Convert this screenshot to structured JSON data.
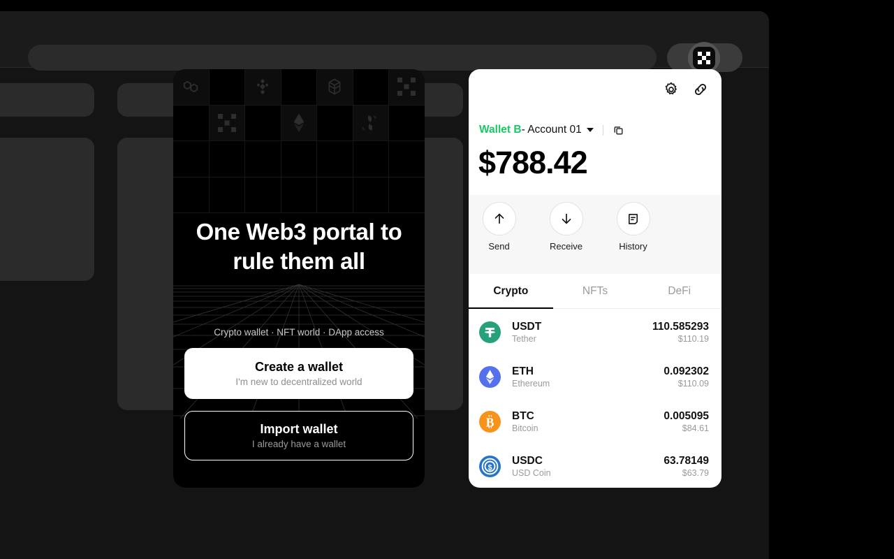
{
  "browser": {
    "omnibox": {
      "value": "",
      "placeholder": ""
    },
    "extension_button": {
      "name": "Web3 wallet extension",
      "icon": "checkerboard-icon"
    }
  },
  "onboarding": {
    "title": "One Web3 portal to rule them all",
    "subtitle": "Crypto wallet · NFT world · DApp access",
    "create_button": {
      "title": "Create a wallet",
      "subtitle": "I'm new to decentralized world"
    },
    "import_button": {
      "title": "Import wallet",
      "subtitle": "I already have a wallet"
    },
    "logo_grid": [
      "polygon-icon",
      "binance-icon",
      "fantom-icon",
      "checkerboard-icon",
      "checkerboard-icon",
      "ethereum-icon",
      "swap-icon"
    ]
  },
  "wallet": {
    "header_icons": [
      "gear-icon",
      "link-icon"
    ],
    "wallet_name": "Wallet B",
    "account_separator": " - ",
    "account_name": "Account 01",
    "copy_icon": "copy-icon",
    "balance": "$788.42",
    "actions": [
      {
        "label": "Send",
        "icon": "arrow-up-icon"
      },
      {
        "label": "Receive",
        "icon": "arrow-down-icon"
      },
      {
        "label": "History",
        "icon": "document-icon"
      }
    ],
    "tabs": [
      {
        "label": "Crypto",
        "active": true
      },
      {
        "label": "NFTs",
        "active": false
      },
      {
        "label": "DeFi",
        "active": false
      }
    ],
    "tokens": [
      {
        "symbol": "USDT",
        "name": "Tether",
        "amount": "110.585293",
        "fiat": "$110.19",
        "color": "#26a17b"
      },
      {
        "symbol": "ETH",
        "name": "Ethereum",
        "amount": "0.092302",
        "fiat": "$110.09",
        "color": "#5470ec"
      },
      {
        "symbol": "BTC",
        "name": "Bitcoin",
        "amount": "0.005095",
        "fiat": "$84.61",
        "color": "#f7931a"
      },
      {
        "symbol": "USDC",
        "name": "USD Coin",
        "amount": "63.78149",
        "fiat": "$63.79",
        "color": "#2775ca"
      }
    ]
  },
  "colors": {
    "accent_green": "#18c964",
    "page_bg": "#000000",
    "popup_bg": "#ffffff"
  }
}
